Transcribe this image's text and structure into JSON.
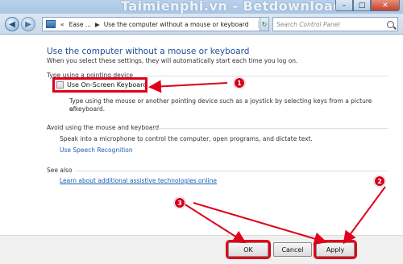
{
  "window": {
    "watermark": "Taimienphi.vn - Betdownload",
    "minimize_label": "–",
    "maximize_label": "□",
    "close_label": "✕"
  },
  "navigation": {
    "back_label": "◀",
    "forward_label": "▶",
    "breadcrumb": [
      "«",
      "Ease ...",
      "Use the computer without a mouse or keyboard"
    ],
    "breadcrumb_sep": "▶",
    "dropdown_label": "▾",
    "refresh_label": "↻",
    "search_placeholder": "Search Control Panel"
  },
  "page": {
    "title": "Use the computer without a mouse or keyboard",
    "subtitle": "When you select these settings, they will automatically start each time you log on."
  },
  "sections": {
    "pointing": {
      "heading": "Type using a pointing device",
      "checkbox_label": "Use On-Screen Keyboard",
      "checked": false,
      "description_line1": "Type using the mouse or another pointing device such as a joystick by selecting keys from a picture of",
      "description_line2": "a keyboard."
    },
    "avoid": {
      "heading": "Avoid using the mouse and keyboard",
      "description": "Speak into a microphone to control the computer, open programs, and dictate text.",
      "link": "Use Speech Recognition"
    },
    "see_also": {
      "heading": "See also",
      "link": "Learn about additional assistive technologies online"
    }
  },
  "annotations": {
    "badge1": "1",
    "badge2": "2",
    "badge3": "3",
    "highlight_color": "#e0001a"
  },
  "buttons": {
    "ok": "OK",
    "cancel": "Cancel",
    "apply": "Apply"
  }
}
